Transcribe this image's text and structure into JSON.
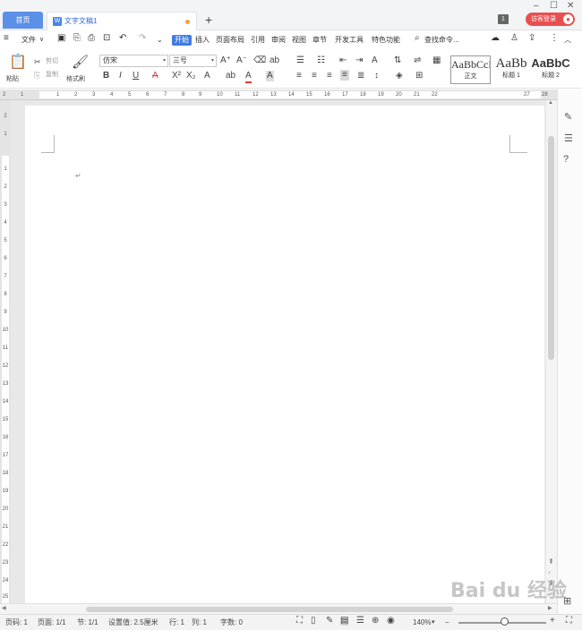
{
  "tabs": {
    "home": "首页",
    "doc": "文字文稿1",
    "new": "+"
  },
  "window": {
    "badge": "1",
    "login": "访客登录",
    "avatar_icon": "user-icon"
  },
  "menu": {
    "file": "文件",
    "items": [
      "开始",
      "插入",
      "页面布局",
      "引用",
      "审阅",
      "视图",
      "章节",
      "开发工具",
      "特色功能"
    ],
    "search": "查找命令..."
  },
  "ribbon": {
    "paste": "粘贴",
    "cut": "剪切",
    "copy": "复制",
    "format_painter": "格式刷",
    "font_name": "仿宋",
    "font_size": "三号",
    "styles": [
      {
        "sample": "AaBbCcDd",
        "name": "正文"
      },
      {
        "sample": "AaBb",
        "name": "标题 1"
      },
      {
        "sample": "AaBbC",
        "name": "标题 2"
      }
    ]
  },
  "ruler": {
    "h_ticks": [
      "2",
      "1",
      "1",
      "2",
      "3",
      "4",
      "5",
      "6",
      "7",
      "8",
      "9",
      "10",
      "11",
      "12",
      "13",
      "14",
      "15",
      "16",
      "17",
      "18",
      "19",
      "20",
      "21",
      "22",
      "27",
      "28"
    ],
    "v_ticks": [
      "2",
      "1",
      "1",
      "2",
      "3",
      "4",
      "5",
      "6",
      "7",
      "8",
      "9",
      "10",
      "11",
      "12",
      "13",
      "14",
      "15",
      "16",
      "17",
      "18",
      "19",
      "20",
      "21",
      "22",
      "23",
      "24",
      "25"
    ]
  },
  "status": {
    "page_num": "页码: 1",
    "pages": "页面: 1/1",
    "section": "节: 1/1",
    "setting": "设置值: 2.5厘米",
    "row": "行: 1",
    "col": "列: 1",
    "words": "字数: 0",
    "zoom": "140%"
  },
  "watermark": "Bai du 经验",
  "colors": {
    "accent": "#3f7be0",
    "login": "#e8504f",
    "modified_dot": "#f3a13c"
  }
}
